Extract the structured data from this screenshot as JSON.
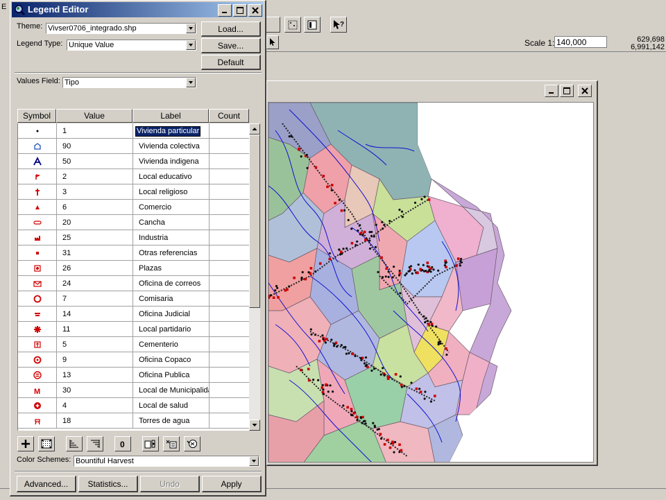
{
  "background_app": {
    "menu_fragment": "E",
    "scale_label": "Scale 1:",
    "scale_value": "140,000",
    "coord_x": "629,698",
    "coord_y": "6,991,142"
  },
  "dialog": {
    "title": "Legend Editor",
    "theme_label": "Theme:",
    "theme_value": "Vivser0706_integrado.shp",
    "legend_type_label": "Legend Type:",
    "legend_type_value": "Unique Value",
    "values_field_label": "Values Field:",
    "values_field_value": "Tipo",
    "buttons": {
      "load": "Load...",
      "save": "Save...",
      "default": "Default"
    },
    "columns": [
      "Symbol",
      "Value",
      "Label",
      "Count"
    ],
    "rows": [
      {
        "symbol": "dot-icon",
        "value": "1",
        "label": "Vivienda particular"
      },
      {
        "symbol": "house-icon",
        "value": "90",
        "label": "Vivienda colectiva"
      },
      {
        "symbol": "indigenous-house-icon",
        "value": "50",
        "label": "Vivienda indigena"
      },
      {
        "symbol": "school-icon",
        "value": "2",
        "label": "Local educativo"
      },
      {
        "symbol": "church-icon",
        "value": "3",
        "label": "Local religioso"
      },
      {
        "symbol": "triangle-icon",
        "value": "6",
        "label": "Comercio"
      },
      {
        "symbol": "field-icon",
        "value": "20",
        "label": "Cancha"
      },
      {
        "symbol": "factory-icon",
        "value": "25",
        "label": "Industria"
      },
      {
        "symbol": "square-icon",
        "value": "31",
        "label": "Otras referencias"
      },
      {
        "symbol": "plaza-icon",
        "value": "26",
        "label": "Plazas"
      },
      {
        "symbol": "envelope-icon",
        "value": "24",
        "label": "Oficina de correos"
      },
      {
        "symbol": "police-icon",
        "value": "7",
        "label": "Comisaria"
      },
      {
        "symbol": "court-icon",
        "value": "14",
        "label": "Oficina Judicial"
      },
      {
        "symbol": "star-icon",
        "value": "11",
        "label": "Local partidario"
      },
      {
        "symbol": "cemetery-icon",
        "value": "5",
        "label": "Cementerio"
      },
      {
        "symbol": "phone-icon",
        "value": "9",
        "label": "Oficina Copaco"
      },
      {
        "symbol": "public-office-icon",
        "value": "13",
        "label": "Oficina Publica"
      },
      {
        "symbol": "municipality-icon",
        "value": "30",
        "label": "Local de Municipalida"
      },
      {
        "symbol": "health-icon",
        "value": "4",
        "label": "Local de salud"
      },
      {
        "symbol": "water-tower-icon",
        "value": "18",
        "label": "Torres de agua"
      }
    ],
    "color_schemes_label": "Color Schemes:",
    "color_schemes_value": "Bountiful Harvest",
    "bottom_buttons": {
      "advanced": "Advanced...",
      "statistics": "Statistics...",
      "undo": "Undo",
      "apply": "Apply"
    }
  },
  "colors": {
    "title_start": "#0a246a",
    "title_end": "#a6caf0",
    "symbol_red": "#d00000"
  }
}
